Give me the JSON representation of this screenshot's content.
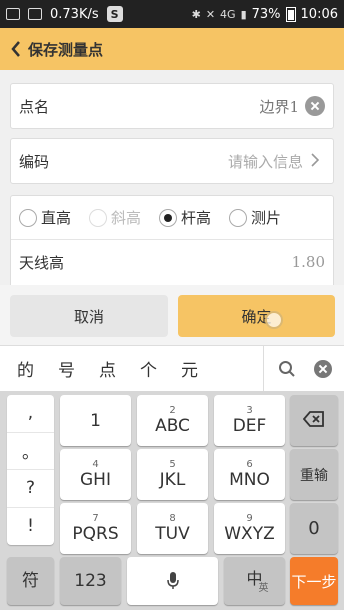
{
  "status_bar": {
    "speed": "0.73K/s",
    "network": "4G",
    "battery": "73%",
    "time": "10:06"
  },
  "header": {
    "title": "保存测量点",
    "back_icon": "chevron-left-icon"
  },
  "form": {
    "point_name_label": "点名",
    "point_name_value": "边界1",
    "code_label": "编码",
    "code_placeholder": "请输入信息",
    "height_types": [
      "直高",
      "斜高",
      "杆高",
      "测片"
    ],
    "selected_height_type": "杆高",
    "antenna_label": "天线高",
    "antenna_value": "1.80"
  },
  "actions": {
    "cancel": "取消",
    "ok": "确定"
  },
  "ime": {
    "candidates": [
      "的",
      "号",
      "点",
      "个",
      "元"
    ],
    "punctuation": [
      ",",
      "。",
      "?",
      "!"
    ],
    "keys": [
      {
        "num": "",
        "letters": "1"
      },
      {
        "num": "2",
        "letters": "ABC"
      },
      {
        "num": "3",
        "letters": "DEF"
      },
      {
        "num": "4",
        "letters": "GHI"
      },
      {
        "num": "5",
        "letters": "JKL"
      },
      {
        "num": "6",
        "letters": "MNO"
      },
      {
        "num": "7",
        "letters": "PQRS"
      },
      {
        "num": "8",
        "letters": "TUV"
      },
      {
        "num": "9",
        "letters": "WXYZ"
      }
    ],
    "reenter": "重输",
    "zero": "0",
    "symbol": "符",
    "num_mode": "123",
    "lang_main": "中",
    "lang_sub": "英",
    "next": "下一步"
  }
}
